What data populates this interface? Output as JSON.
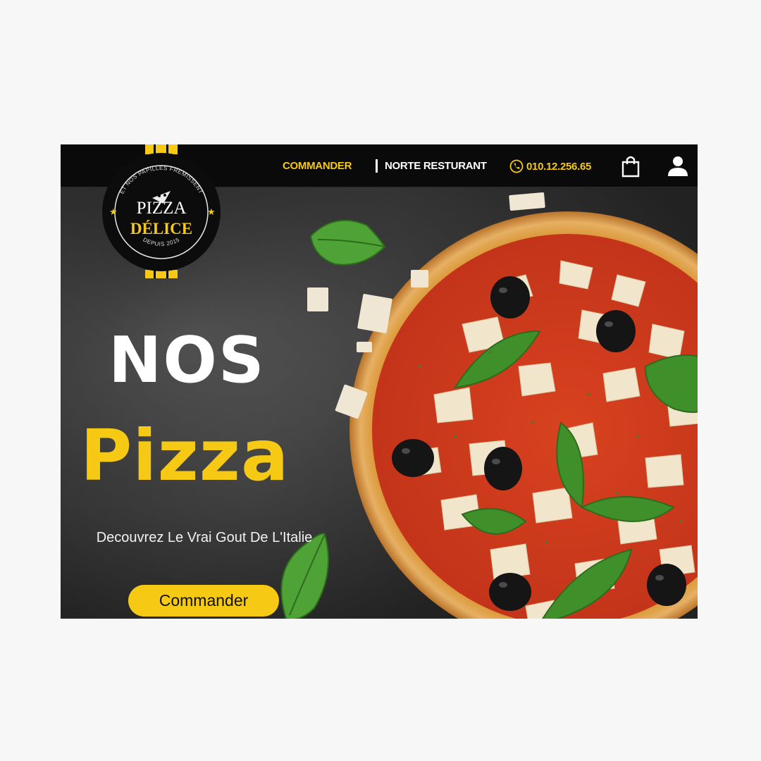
{
  "nav": {
    "commander": "COMMANDER",
    "restaurant": "NORTE RESTURANT",
    "phone": "010.12.256.65",
    "bag_icon": "shopping-bag-icon",
    "user_icon": "user-icon",
    "phone_icon": "phone-icon"
  },
  "logo": {
    "arc_top": "ET NOS PAPILLES FREMISSENT",
    "line1": "PIZZA",
    "line2": "DÉLICE",
    "arc_bottom": "DEPUIS 2015"
  },
  "hero": {
    "title_line1": "NOS",
    "title_line2": "Pizza",
    "subtitle": "Decouvrez Le Vrai Gout De L'Italie",
    "cta_label": "Commander"
  },
  "colors": {
    "accent": "#f6c915",
    "navbar": "#0a0a0a",
    "background": "#2b2b2b",
    "page": "#f7f7f7"
  }
}
